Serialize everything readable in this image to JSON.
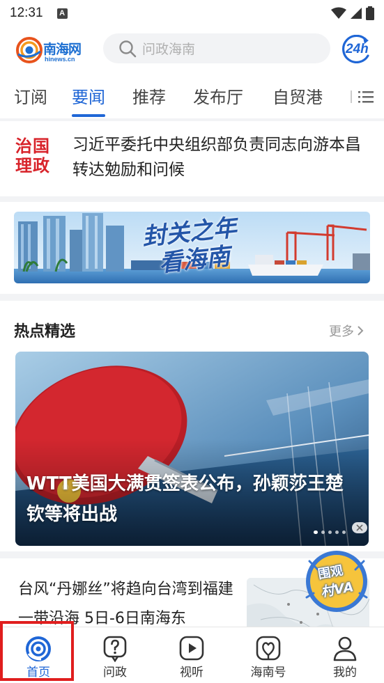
{
  "status_bar": {
    "time": "12:31",
    "notification_letter": "A"
  },
  "header": {
    "logo_text": "南海网",
    "logo_subtext": "hinews.cn",
    "search_placeholder": "问政海南",
    "clock_badge": "24h"
  },
  "tabs": [
    {
      "label": "订阅",
      "active": false
    },
    {
      "label": "要闻",
      "active": true
    },
    {
      "label": "推荐",
      "active": false
    },
    {
      "label": "发布厅",
      "active": false
    },
    {
      "label": "自贸港",
      "active": false
    }
  ],
  "headline": {
    "seal_lines": [
      "治国",
      "理政"
    ],
    "text": "习近平委托中央组织部负责同志向游本昌转达勉励和问候"
  },
  "banner": {
    "title_line1": "封关之年",
    "title_line2": "看海南"
  },
  "hot": {
    "title": "热点精选",
    "more_label": "更多",
    "feature_caption": "WTT美国大满贯签表公布，孙颖莎王楚钦等将出战",
    "carousel_total": 5,
    "carousel_active": 1
  },
  "news_item": {
    "text": "台风“丹娜丝”将趋向台湾到福建一带沿海 5日-6日南海东",
    "badge_line1": "围观",
    "badge_line2": "村VA"
  },
  "bottom_nav": [
    {
      "label": "首页",
      "icon": "home-swirl-icon",
      "active": true
    },
    {
      "label": "问政",
      "icon": "question-bubble-icon",
      "active": false
    },
    {
      "label": "视听",
      "icon": "play-icon",
      "active": false
    },
    {
      "label": "海南号",
      "icon": "hainan-account-icon",
      "active": false
    },
    {
      "label": "我的",
      "icon": "user-icon",
      "active": false
    }
  ],
  "colors": {
    "accent": "#1f66d6",
    "seal_red": "#d8232a",
    "highlight": "#e01e1e"
  }
}
